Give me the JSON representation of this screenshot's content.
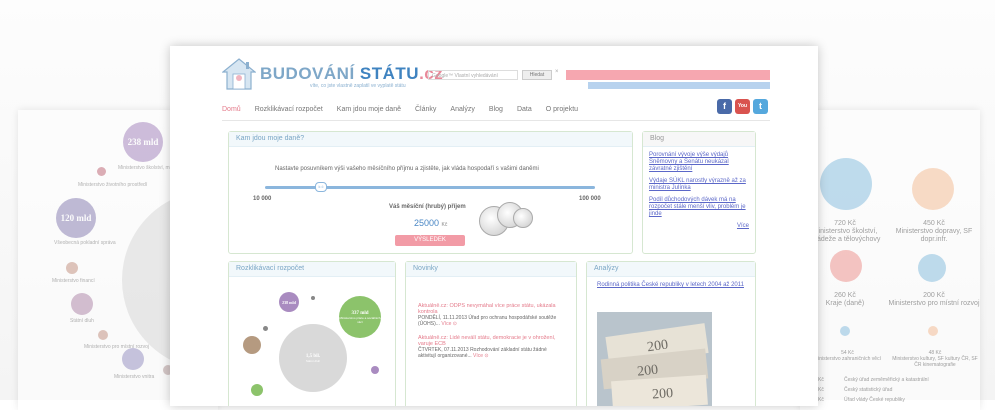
{
  "main": {
    "logo": {
      "part1": "BUDOVÁNÍ",
      "part2": "STÁTU",
      "part3": ".cz"
    },
    "tagline": "víte, co jste vlastně zaplatil ve vyplatě státu",
    "search": {
      "placeholder": "Google™ Vlastní vyhledávání",
      "button": "Hledat",
      "close": "×"
    },
    "nav": [
      "Domů",
      "Rozklikávací rozpočet",
      "Kam jdou moje daně",
      "Články",
      "Analýzy",
      "Blog",
      "Data",
      "O projektu"
    ],
    "social": {
      "facebook": "f",
      "youtube": "You",
      "twitter": "t"
    },
    "calculator": {
      "title": "Kam jdou moje daně?",
      "intro": "Nastavte posuvníkem výši vašeho měsíčního příjmu a zjistěte, jak vláda hospodaří s vašimi daněmi",
      "min": "10 000",
      "max": "100 000",
      "knob": "k č",
      "income_label": "Váš měsíční (hrubý) příjem",
      "income_value": "25000",
      "currency": "Kč",
      "button": "VÝSLEDEK"
    },
    "blog": {
      "title": "Blog",
      "links": [
        "Porovnání vývoje výše výdajů Sněmovny a Senátu neukázal závratné zjištění",
        "Výdaje SÚKL narostly výrazně až za ministra Julínka",
        "Podíl důchodových dávek má na rozpočet stále menší vliv, problém je jinde"
      ],
      "more": "Více"
    },
    "budget": {
      "title": "Rozklikávací rozpočet",
      "bubbles": [
        "238 mld",
        "337 mld",
        "1,5 bil."
      ],
      "bubble_sub": "Ministerstvo práce a sociálních věcí",
      "bubble_big_sub": "Státní dluh"
    },
    "news": {
      "title": "Novinky",
      "items": [
        {
          "headline": "Aktuálně.cz: ODPS nevymáhal více práce státu, ukázala kontrola",
          "body": "PONDĚLÍ, 11.11.2013 Úřad pro ochranu hospodářské soutěže (ÚOHS)...",
          "more": "Více ⊙"
        },
        {
          "headline": "Aktuálně.cz: Lidé neválí státu, demokracie je v ohrožení, varuje ECB",
          "body": "ČTVRTEK, 07.11.2013 Rozhodování základní státu žádné aktivitují organizované...",
          "more": "Více ⊙"
        }
      ]
    },
    "analyses": {
      "title": "Analýzy",
      "link": "Rodinná politika České republiky v letech 2004 až 2011"
    }
  },
  "left": {
    "bubbles": [
      "238 mld",
      "120 mld"
    ],
    "labels": [
      "Ministerstvo školství, mládeže a tělovýchovy",
      "Ministerstvo životního prostředí",
      "Všeobecná pokladní správa",
      "Ministerstvo financí",
      "Státní dluh",
      "Ministerstvo pro místní rozvoj",
      "Ministerstvo vnitra"
    ]
  },
  "right": {
    "items": [
      {
        "value": "720 Kč",
        "label": "Ministerstvo školství, mládeže a tělovýchovy"
      },
      {
        "value": "450 Kč",
        "label": "Ministerstvo dopravy, SF dopr.infr."
      },
      {
        "value": "260 Kč",
        "label": "Kraje (daně)"
      },
      {
        "value": "200 Kč",
        "label": "Ministerstvo pro místní rozvoj"
      },
      {
        "value": "54 Kč",
        "label": "Ministerstvo zahraničních věcí"
      },
      {
        "value": "48 Kč",
        "label": "Ministerstvo kultury, SF kultury ČR, SF ČR kinematografie"
      }
    ],
    "list": [
      "Český úřad zeměměřický a katastrální",
      "Český statistický úřad",
      "Úřad vlády České republiky"
    ],
    "list_prefix": [
      "Kč",
      "Kč",
      "Kč"
    ]
  }
}
